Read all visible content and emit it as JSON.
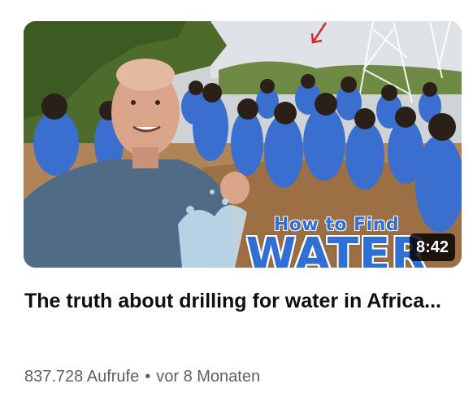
{
  "video": {
    "thumbnail": {
      "headline_small": "How to Find",
      "headline_big": "WATER",
      "duration": "8:42",
      "colors": {
        "headline": "#2f6fd6",
        "sky": "#d9dde2",
        "uniforms": "#3a6fd0",
        "shirt": "#4f6b86"
      }
    },
    "title": "The truth about drilling for water in Africa...",
    "views": "837.728 Aufrufe",
    "separator": "•",
    "age": "vor 8 Monaten"
  }
}
